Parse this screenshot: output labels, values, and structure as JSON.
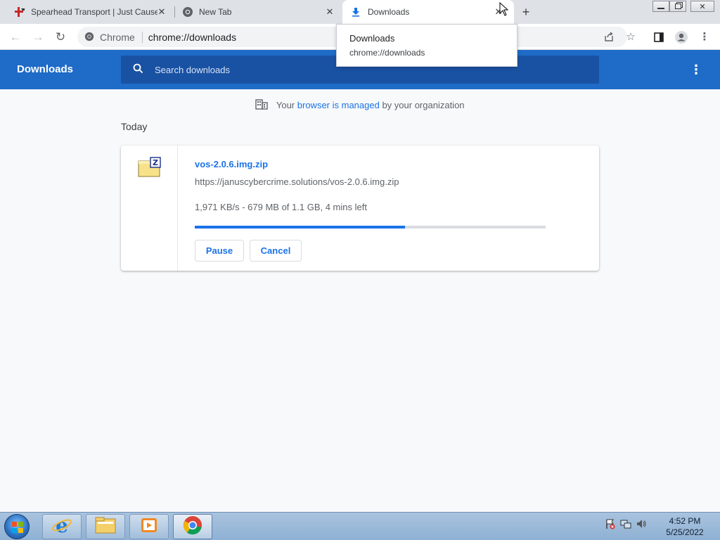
{
  "browser": {
    "tabs": [
      {
        "title": "Spearhead Transport | Just Cause",
        "favicon": "spearhead-logo-icon",
        "active": false
      },
      {
        "title": "New Tab",
        "favicon": "chrome-icon",
        "active": false
      },
      {
        "title": "Downloads",
        "favicon": "download-icon",
        "active": true
      }
    ],
    "tab_close_glyph": "✕",
    "new_tab_glyph": "+",
    "omnibox": {
      "site_label": "Chrome",
      "url": "chrome://downloads"
    },
    "tooltip": {
      "title": "Downloads",
      "url": "chrome://downloads"
    }
  },
  "downloads_page": {
    "title": "Downloads",
    "search": {
      "placeholder": "Search downloads"
    },
    "managed_notice": {
      "prefix": "Your",
      "link": "browser is managed",
      "suffix": "by your organization"
    },
    "section_label": "Today",
    "items": [
      {
        "filename": "vos-2.0.6.img.zip",
        "url": "https://januscybercrime.solutions/vos-2.0.6.img.zip",
        "status": "1,971 KB/s - 679 MB of 1.1 GB, 4 mins left",
        "progress_fraction": 0.6,
        "actions": {
          "pause": "Pause",
          "cancel": "Cancel"
        }
      }
    ]
  },
  "taskbar": {
    "pinned": [
      "internet-explorer-icon",
      "file-explorer-icon",
      "media-player-icon",
      "chrome-icon"
    ],
    "clock": {
      "time": "4:52 PM",
      "date": "5/25/2022"
    }
  },
  "colors": {
    "header_blue": "#1e6bc8",
    "search_blue": "#1a52a3",
    "link_blue": "#1a73e8",
    "tabstrip_gray": "#dee1e6"
  }
}
